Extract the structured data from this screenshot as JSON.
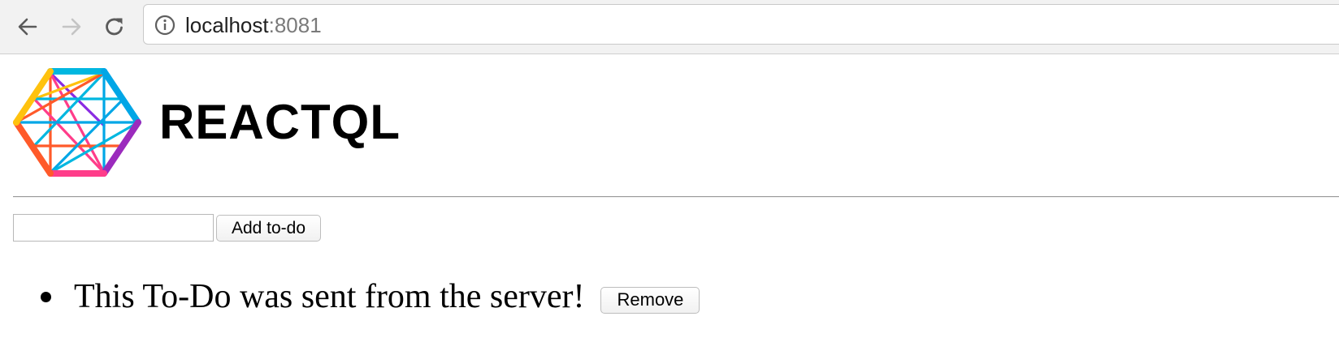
{
  "browser": {
    "url_host": "localhost",
    "url_port": ":8081",
    "icons": {
      "back": "arrow-left-icon",
      "forward": "arrow-right-icon",
      "reload": "reload-icon",
      "info": "info-icon"
    }
  },
  "header": {
    "brand": "REACTQL",
    "logo": "reactql-hexagon-logo"
  },
  "form": {
    "input_value": "",
    "input_placeholder": "",
    "add_label": "Add to-do"
  },
  "todos": [
    {
      "text": "This To-Do was sent from the server!",
      "remove_label": "Remove"
    }
  ],
  "colors": {
    "chrome_bg": "#f2f2f2",
    "page_bg": "#ffffff",
    "text": "#000000",
    "url_port": "#7a7a7a"
  }
}
